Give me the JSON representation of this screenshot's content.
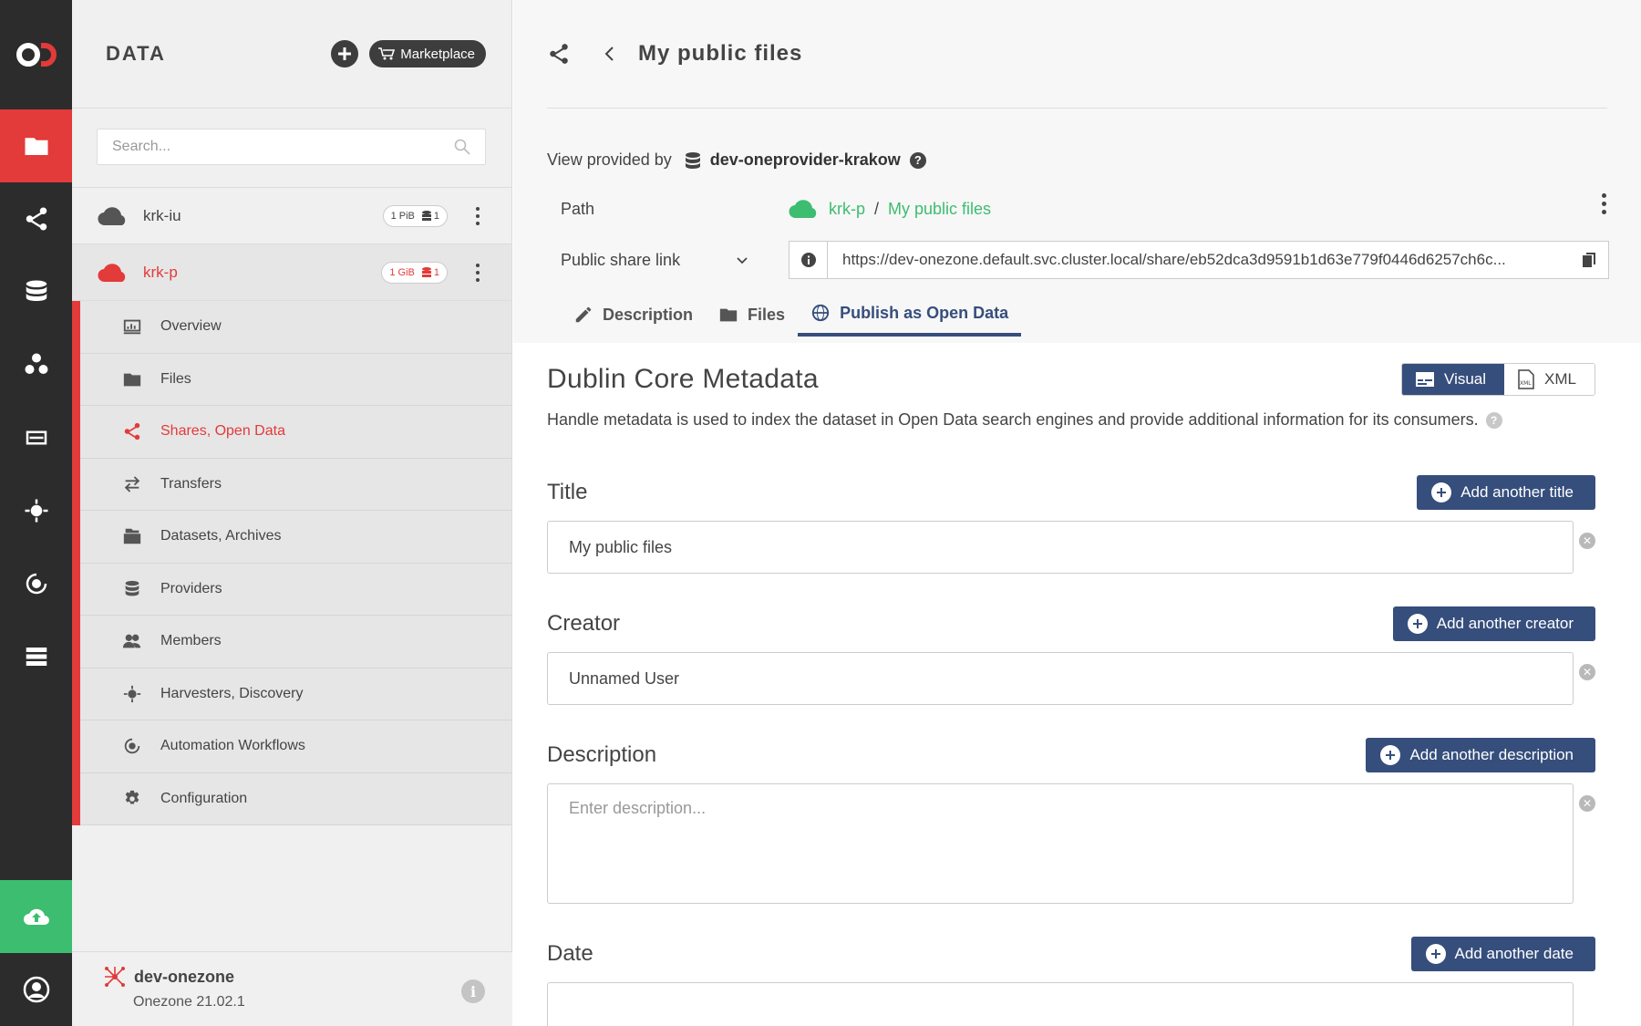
{
  "rail": {
    "items": [
      "data-icon",
      "share-icon",
      "database-icon",
      "groups-icon",
      "tokens-icon",
      "harvester-icon",
      "automation-icon",
      "clusters-icon"
    ],
    "upload_icon": "upload-cloud-icon",
    "user_icon": "user-icon"
  },
  "sidebar": {
    "title": "DATA",
    "marketplace_label": "Marketplace",
    "search_placeholder": "Search...",
    "spaces": [
      {
        "name": "krk-iu",
        "size": "1 PiB",
        "providers": "1",
        "active": false
      },
      {
        "name": "krk-p",
        "size": "1 GiB",
        "providers": "1",
        "active": true
      }
    ],
    "submenu": [
      {
        "label": "Overview",
        "icon": "overview-icon"
      },
      {
        "label": "Files",
        "icon": "folder-icon"
      },
      {
        "label": "Shares, Open Data",
        "icon": "share-icon",
        "active": true
      },
      {
        "label": "Transfers",
        "icon": "transfers-icon"
      },
      {
        "label": "Datasets, Archives",
        "icon": "datasets-icon"
      },
      {
        "label": "Providers",
        "icon": "providers-icon"
      },
      {
        "label": "Members",
        "icon": "members-icon"
      },
      {
        "label": "Harvesters, Discovery",
        "icon": "harvester-icon"
      },
      {
        "label": "Automation Workflows",
        "icon": "automation-icon"
      },
      {
        "label": "Configuration",
        "icon": "gear-icon"
      }
    ],
    "footer": {
      "zone": "dev-onezone",
      "version": "Onezone 21.02.1"
    }
  },
  "main": {
    "title": "My public files",
    "provided_by_label": "View provided by",
    "provider": "dev-oneprovider-krakow",
    "path_label": "Path",
    "path": [
      "krk-p",
      "My public files"
    ],
    "link_label": "Public share link",
    "link": "https://dev-onezone.default.svc.cluster.local/share/eb52dca3d9591b1d63e779f0446d6257ch6c...",
    "tabs": [
      "Description",
      "Files",
      "Publish as Open Data"
    ],
    "active_tab": 2,
    "dc_title": "Dublin Core Metadata",
    "mode_visual": "Visual",
    "mode_xml": "XML",
    "dc_description": "Handle metadata is used to index the dataset in Open Data search engines and provide additional information for its consumers.",
    "fields": {
      "title": {
        "label": "Title",
        "button": "Add another title",
        "value": "My public files"
      },
      "creator": {
        "label": "Creator",
        "button": "Add another creator",
        "value": "Unnamed User"
      },
      "description": {
        "label": "Description",
        "button": "Add another description",
        "placeholder": "Enter description..."
      },
      "date": {
        "label": "Date",
        "button": "Add another date"
      }
    }
  },
  "colors": {
    "accent_red": "#e33a3a",
    "navy": "#364e7c",
    "green": "#3dbd6f",
    "rail": "#2c2c2c"
  }
}
